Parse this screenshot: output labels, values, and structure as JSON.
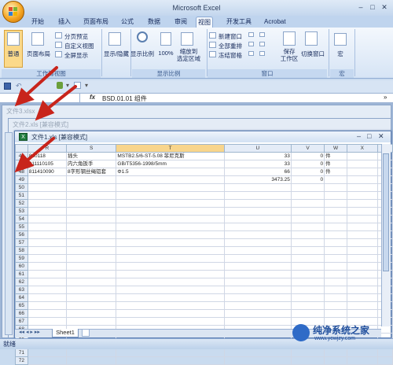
{
  "app": {
    "title": "Microsoft Excel"
  },
  "tabs": [
    "开始",
    "插入",
    "页面布局",
    "公式",
    "数据",
    "审阅",
    "视图",
    "开发工具",
    "Acrobat"
  ],
  "ribbon": {
    "btn_normal": "普通",
    "btn_pagelayout": "页面布局",
    "btn_pagebreak": "分页预览",
    "btn_customview": "自定义视图",
    "btn_fullscreen": "全屏显示",
    "group_workbook_views": "工作簿视图",
    "btn_show_hide": "显示/隐藏",
    "btn_zoom": "显示比例",
    "btn_zoom100": "100%",
    "btn_zoom_selection": "缩放到\n选定区域",
    "group_zoom": "显示比例",
    "btn_new_window": "新建窗口",
    "btn_arrange_all": "全部重排",
    "btn_freeze": "冻结窗格",
    "btn_save_workspace": "保存\n工作区",
    "btn_switch_windows": "切换窗口",
    "group_window": "窗口",
    "btn_macros": "宏",
    "group_macros": "宏"
  },
  "formula_bar": {
    "fx": "fx",
    "value": "BSD.01.01  组件"
  },
  "windows": {
    "win3": "文件3.xlsx",
    "win2": "文件2.xls [兼容模式]",
    "win1": "文件1.xls [兼容模式]"
  },
  "sheet": {
    "columns": [
      "R",
      "S",
      "T",
      "U",
      "V",
      "W",
      "X",
      "Y"
    ],
    "rows": [
      {
        "n": "46",
        "R": "810118",
        "S": "插头",
        "T": "MSTB2.5/6-ST-5.08 菲尼克斯",
        "U": "33",
        "V": "0",
        "W": "件"
      },
      {
        "n": "47",
        "R": "811110105",
        "S": "内六角扳手",
        "T": "GB/T5356-1998/5mm",
        "U": "33",
        "V": "0",
        "W": "件"
      },
      {
        "n": "48",
        "R": "811410090",
        "S": "8字形钢丝绳铝套",
        "T": "Φ1.5",
        "U": "66",
        "V": "0",
        "W": "件"
      },
      {
        "n": "49",
        "R": "",
        "S": "",
        "T": "",
        "U": "3473.25",
        "V": "0",
        "W": ""
      },
      {
        "n": "50"
      },
      {
        "n": "51"
      },
      {
        "n": "52"
      },
      {
        "n": "53"
      },
      {
        "n": "54"
      },
      {
        "n": "55"
      },
      {
        "n": "56"
      },
      {
        "n": "57"
      },
      {
        "n": "58"
      },
      {
        "n": "59"
      },
      {
        "n": "60"
      },
      {
        "n": "61"
      },
      {
        "n": "62"
      },
      {
        "n": "63"
      },
      {
        "n": "64"
      },
      {
        "n": "65"
      },
      {
        "n": "66"
      },
      {
        "n": "67"
      },
      {
        "n": "68"
      },
      {
        "n": "69"
      },
      {
        "n": "70"
      },
      {
        "n": "71"
      },
      {
        "n": "72"
      }
    ],
    "sheet_tab": "Sheet1"
  },
  "status": {
    "text": "就绪"
  },
  "watermark": {
    "line1": "纯净系统之家",
    "line2": "www.ycwjzy.com"
  },
  "colors": {
    "accent": "#c0392b",
    "ribbon": "#d6e4f5"
  }
}
